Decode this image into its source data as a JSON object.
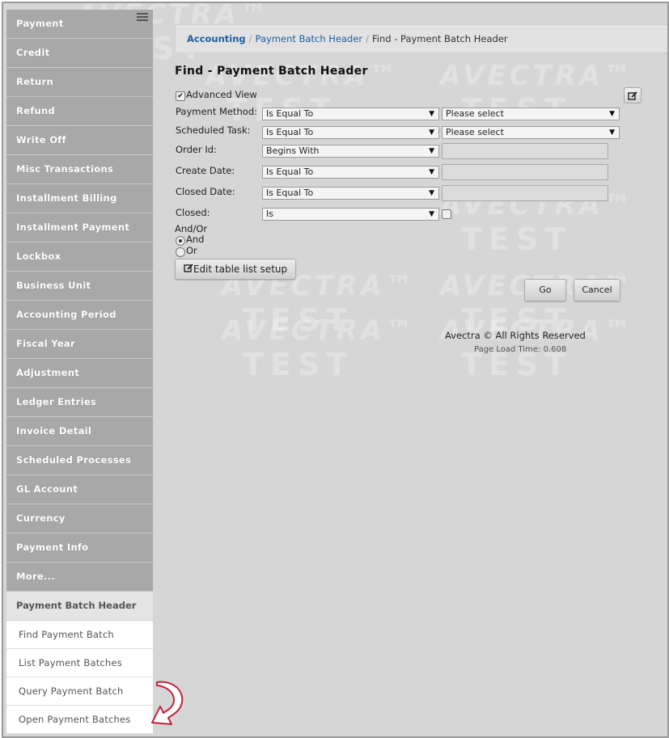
{
  "sidebar": {
    "items": [
      {
        "label": "Payment"
      },
      {
        "label": "Credit"
      },
      {
        "label": "Return"
      },
      {
        "label": "Refund"
      },
      {
        "label": "Write Off"
      },
      {
        "label": "Misc Transactions"
      },
      {
        "label": "Installment Billing"
      },
      {
        "label": "Installment Payment"
      },
      {
        "label": "Lockbox"
      },
      {
        "label": "Business Unit"
      },
      {
        "label": "Accounting Period"
      },
      {
        "label": "Fiscal Year"
      },
      {
        "label": "Adjustment"
      },
      {
        "label": "Ledger Entries"
      },
      {
        "label": "Invoice Detail"
      },
      {
        "label": "Scheduled Processes"
      },
      {
        "label": "GL Account"
      },
      {
        "label": "Currency"
      },
      {
        "label": "Payment Info"
      },
      {
        "label": "More..."
      }
    ],
    "section": {
      "label": "Payment Batch Header"
    },
    "sub_items": [
      {
        "label": "Find Payment Batch"
      },
      {
        "label": "List Payment Batches"
      },
      {
        "label": "Query Payment Batch"
      },
      {
        "label": "Open Payment Batches"
      }
    ]
  },
  "breadcrumb": {
    "items": [
      "Accounting",
      "Payment Batch Header",
      "Find - Payment Batch Header"
    ],
    "separator": "/"
  },
  "page": {
    "title": "Find - Payment Batch Header"
  },
  "form": {
    "advanced_view": {
      "label": "Advanced View",
      "checked": true
    },
    "payment_method": {
      "label": "Payment Method:",
      "operator": "Is Equal To",
      "value": "Please select"
    },
    "scheduled_task": {
      "label": "Scheduled Task:",
      "operator": "Is Equal To",
      "value": "Please select"
    },
    "order_id": {
      "label": "Order Id:",
      "operator": "Begins With",
      "value": ""
    },
    "create_date": {
      "label": "Create Date:",
      "operator": "Is Equal To",
      "value": ""
    },
    "closed_date": {
      "label": "Closed Date:",
      "operator": "Is Equal To",
      "value": ""
    },
    "closed": {
      "label": "Closed:",
      "operator": "Is",
      "checked": false
    },
    "and_or": {
      "label": "And/Or",
      "options": [
        "And",
        "Or"
      ],
      "selected": "And"
    },
    "edit_table_button": "Edit table list setup",
    "go_button": "Go",
    "cancel_button": "Cancel"
  },
  "footer": {
    "copyright": "Avectra © All Rights Reserved",
    "load_time": "Page Load Time: 0.608"
  },
  "watermark": {
    "line1": "AVECTRA™",
    "line2": "TEST"
  },
  "icons": {
    "menu": "hamburger-icon",
    "edit": "edit-icon",
    "dropdown": "chevron-down-icon",
    "arrow": "curved-arrow-icon"
  },
  "colors": {
    "sidebar_bg": "#a8a8a8",
    "content_bg": "#d6d6d6",
    "link": "#1d5fa0"
  }
}
